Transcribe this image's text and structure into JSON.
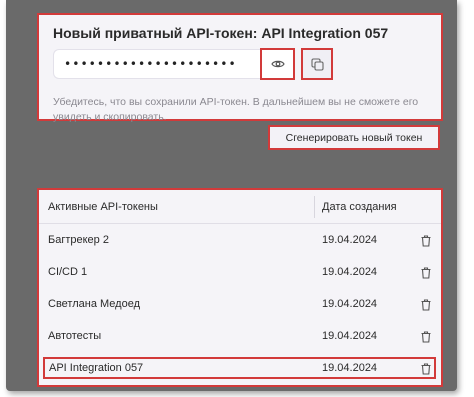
{
  "token_panel": {
    "title": "Новый приватный API-токен: API Integration 057",
    "masked_value": "•••••••••••••••••••••",
    "hint": "Убедитесь, что вы сохранили API-токен. В дальнейшем вы не сможете его увидеть и скопировать."
  },
  "generate_button": {
    "label": "Сгенерировать новый токен"
  },
  "tokens_table": {
    "columns": [
      "Активные API-токены",
      "Дата создания"
    ],
    "rows": [
      {
        "name": "Багтрекер 2",
        "date": "19.04.2024"
      },
      {
        "name": "CI/CD 1",
        "date": "19.04.2024"
      },
      {
        "name": "Светлана Медоед",
        "date": "19.04.2024"
      },
      {
        "name": "Автотесты",
        "date": "19.04.2024"
      },
      {
        "name": "API Integration 057",
        "date": "19.04.2024"
      }
    ]
  },
  "colors": {
    "highlight": "#d23a3a",
    "panel_bg": "#f5f4f8",
    "backdrop": "#6a6a6a"
  },
  "icons": {
    "show": "eye-icon",
    "copy": "copy-icon",
    "delete": "trash-icon"
  }
}
